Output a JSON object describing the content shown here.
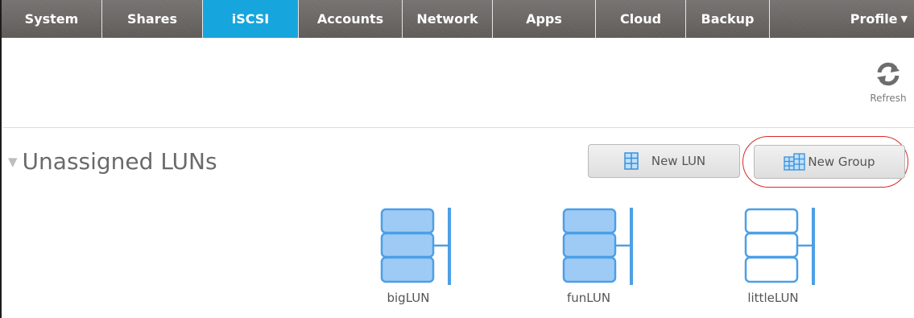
{
  "nav": {
    "tabs": [
      {
        "label": "System",
        "active": false
      },
      {
        "label": "Shares",
        "active": false
      },
      {
        "label": "iSCSI",
        "active": true
      },
      {
        "label": "Accounts",
        "active": false
      },
      {
        "label": "Network",
        "active": false
      },
      {
        "label": "Apps",
        "active": false
      },
      {
        "label": "Cloud",
        "active": false
      },
      {
        "label": "Backup",
        "active": false
      },
      {
        "label": "Profile",
        "active": false,
        "has_dropdown": true
      }
    ]
  },
  "toolbar": {
    "refresh_label": "Refresh",
    "refresh_icon": "refresh-icon"
  },
  "section": {
    "title": "Unassigned LUNs",
    "collapse_icon": "collapse-triangle-icon",
    "new_lun_label": "New LUN",
    "new_group_label": "New Group"
  },
  "luns": [
    {
      "name": "bigLUN",
      "filled": true
    },
    {
      "name": "funLUN",
      "filled": true
    },
    {
      "name": "littleLUN",
      "filled": false
    }
  ],
  "colors": {
    "accent": "#16a6dd",
    "nav_bg": "#6b6864",
    "lun_stroke": "#4d9fe6",
    "lun_fill": "#9ecbf5",
    "highlight": "#d82a2a"
  }
}
